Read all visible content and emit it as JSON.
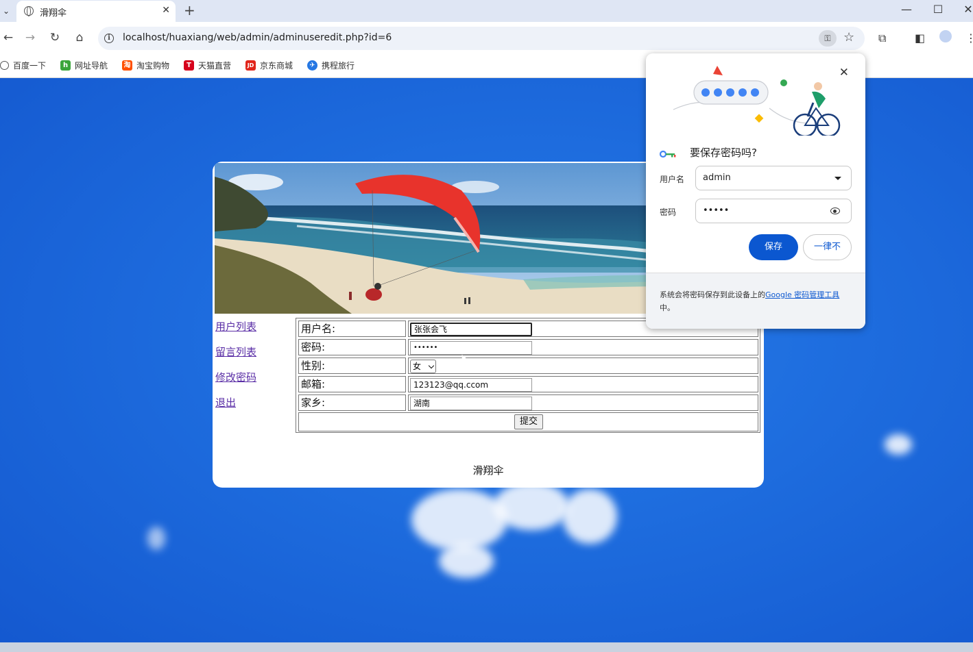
{
  "browser": {
    "tab_title": "滑翔伞",
    "url": "localhost/huaxiang/web/admin/adminuseredit.php?id=6",
    "bookmarks": [
      {
        "label": "百度一下",
        "icon": "baidu-icon",
        "color": "#2932e1"
      },
      {
        "label": "网址导航",
        "icon": "hao123-icon",
        "color": "#3aa53a"
      },
      {
        "label": "淘宝购物",
        "icon": "taobao-icon",
        "color": "#ff5000"
      },
      {
        "label": "天猫直营",
        "icon": "tmall-icon",
        "color": "#d6001c"
      },
      {
        "label": "京东商城",
        "icon": "jd-icon",
        "color": "#e1251b"
      },
      {
        "label": "携程旅行",
        "icon": "ctrip-icon",
        "color": "#2577e3"
      }
    ]
  },
  "sidebar": {
    "links": [
      {
        "label": "用户列表"
      },
      {
        "label": "留言列表"
      },
      {
        "label": "修改密码"
      },
      {
        "label": "退出"
      }
    ]
  },
  "form": {
    "username_label": "用户名:",
    "username_value": "张张会飞",
    "password_label": "密码:",
    "password_value": "••••••",
    "gender_label": "性别:",
    "gender_value": "女",
    "email_label": "邮箱:",
    "email_value": "123123@qq.ccom",
    "hometown_label": "家乡:",
    "hometown_value": "湖南",
    "submit_label": "提交"
  },
  "footer": {
    "text": "滑翔伞"
  },
  "save_password_popup": {
    "title": "要保存密码吗?",
    "username_label": "用户名",
    "username_value": "admin",
    "password_label": "密码",
    "password_value": "•••••",
    "save_label": "保存",
    "never_label": "一律不",
    "footer_prefix": "系统会将密码保存到此设备上的",
    "footer_link": "Google 密码管理工具",
    "footer_suffix": "中。",
    "accent_color": "#0b57d0"
  }
}
